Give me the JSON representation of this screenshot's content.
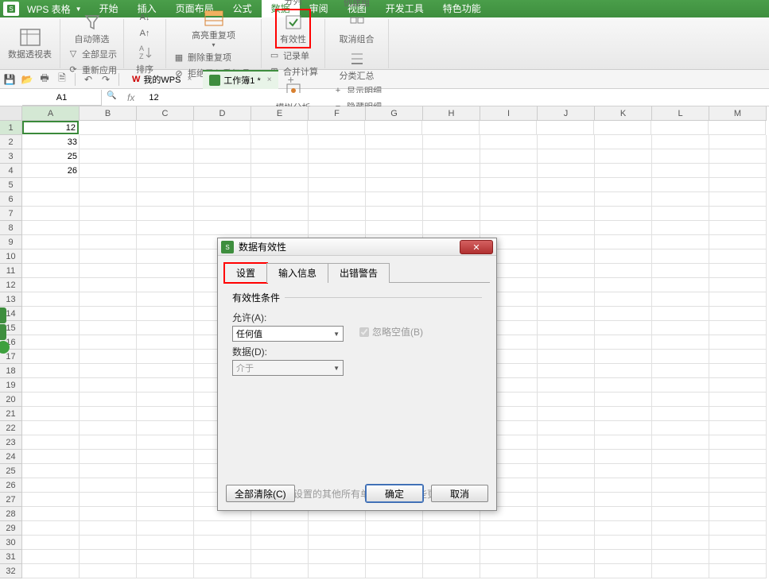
{
  "app": {
    "name": "WPS 表格"
  },
  "menu": {
    "items": [
      "开始",
      "插入",
      "页面布局",
      "公式",
      "数据",
      "审阅",
      "视图",
      "开发工具",
      "特色功能"
    ],
    "active_index": 4
  },
  "ribbon": {
    "pivot": "数据透视表",
    "autofilter": "自动筛选",
    "showall": "全部显示",
    "reapply": "重新应用",
    "sort": "排序",
    "highlight_dup": "高亮重复项",
    "remove_dup": "删除重复项",
    "reject_dup": "拒绝录入重复项",
    "split_col": "分列",
    "validity": "有效性",
    "record": "记录单",
    "consolidate": "合并计算",
    "whatif": "模拟分析",
    "group": "创建组",
    "ungroup": "取消组合",
    "subtotal": "分类汇总",
    "show_detail": "显示明细",
    "hide_detail": "隐藏明细"
  },
  "doc_tabs": {
    "tab1": "我的WPS",
    "tab2": "工作簿1 *"
  },
  "formula": {
    "name_box": "A1",
    "fx": "fx",
    "value": "12"
  },
  "columns": [
    "A",
    "B",
    "C",
    "D",
    "E",
    "F",
    "G",
    "H",
    "I",
    "J",
    "K",
    "L",
    "M"
  ],
  "sheet": {
    "A1": "12",
    "A2": "33",
    "A3": "25",
    "A4": "26"
  },
  "dialog": {
    "title": "数据有效性",
    "tabs": {
      "settings": "设置",
      "input_msg": "输入信息",
      "error_alert": "出错警告"
    },
    "fieldset": "有效性条件",
    "allow_label": "允许(A):",
    "allow_value": "任何值",
    "data_label": "数据(D):",
    "data_value": "介于",
    "ignore_blank": "忽略空值(B)",
    "apply_all": "对所有同样设置的其他所有单元格应用这些更改(P)",
    "clear_all": "全部清除(C)",
    "ok": "确定",
    "cancel": "取消"
  },
  "chart_data": null
}
